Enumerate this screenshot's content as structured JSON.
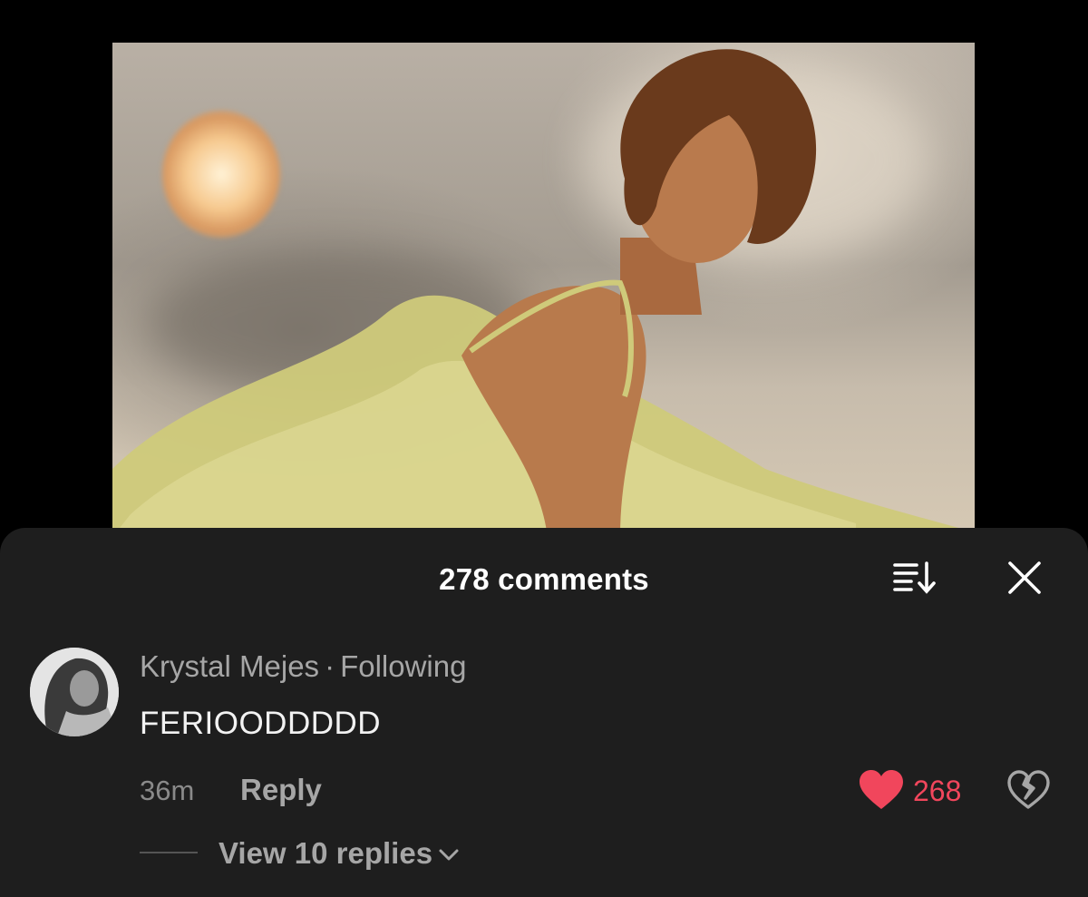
{
  "icons": {
    "sort": "sort-icon",
    "close": "close-icon",
    "like": "heart-icon",
    "dislike": "broken-heart-icon",
    "expand": "chevron-down-icon"
  },
  "colors": {
    "sheet_background": "#1e1e1e",
    "like_active": "#f1465c",
    "secondary_text": "#a6a6a6"
  },
  "comments_sheet": {
    "title": "278 comments",
    "comment": {
      "author": "Krystal Mejes",
      "separator": "·",
      "relationship": "Following",
      "text": "FERIOODDDDD",
      "time": "36m",
      "reply_label": "Reply",
      "like_count": "268",
      "view_replies_label": "View 10 replies"
    }
  }
}
